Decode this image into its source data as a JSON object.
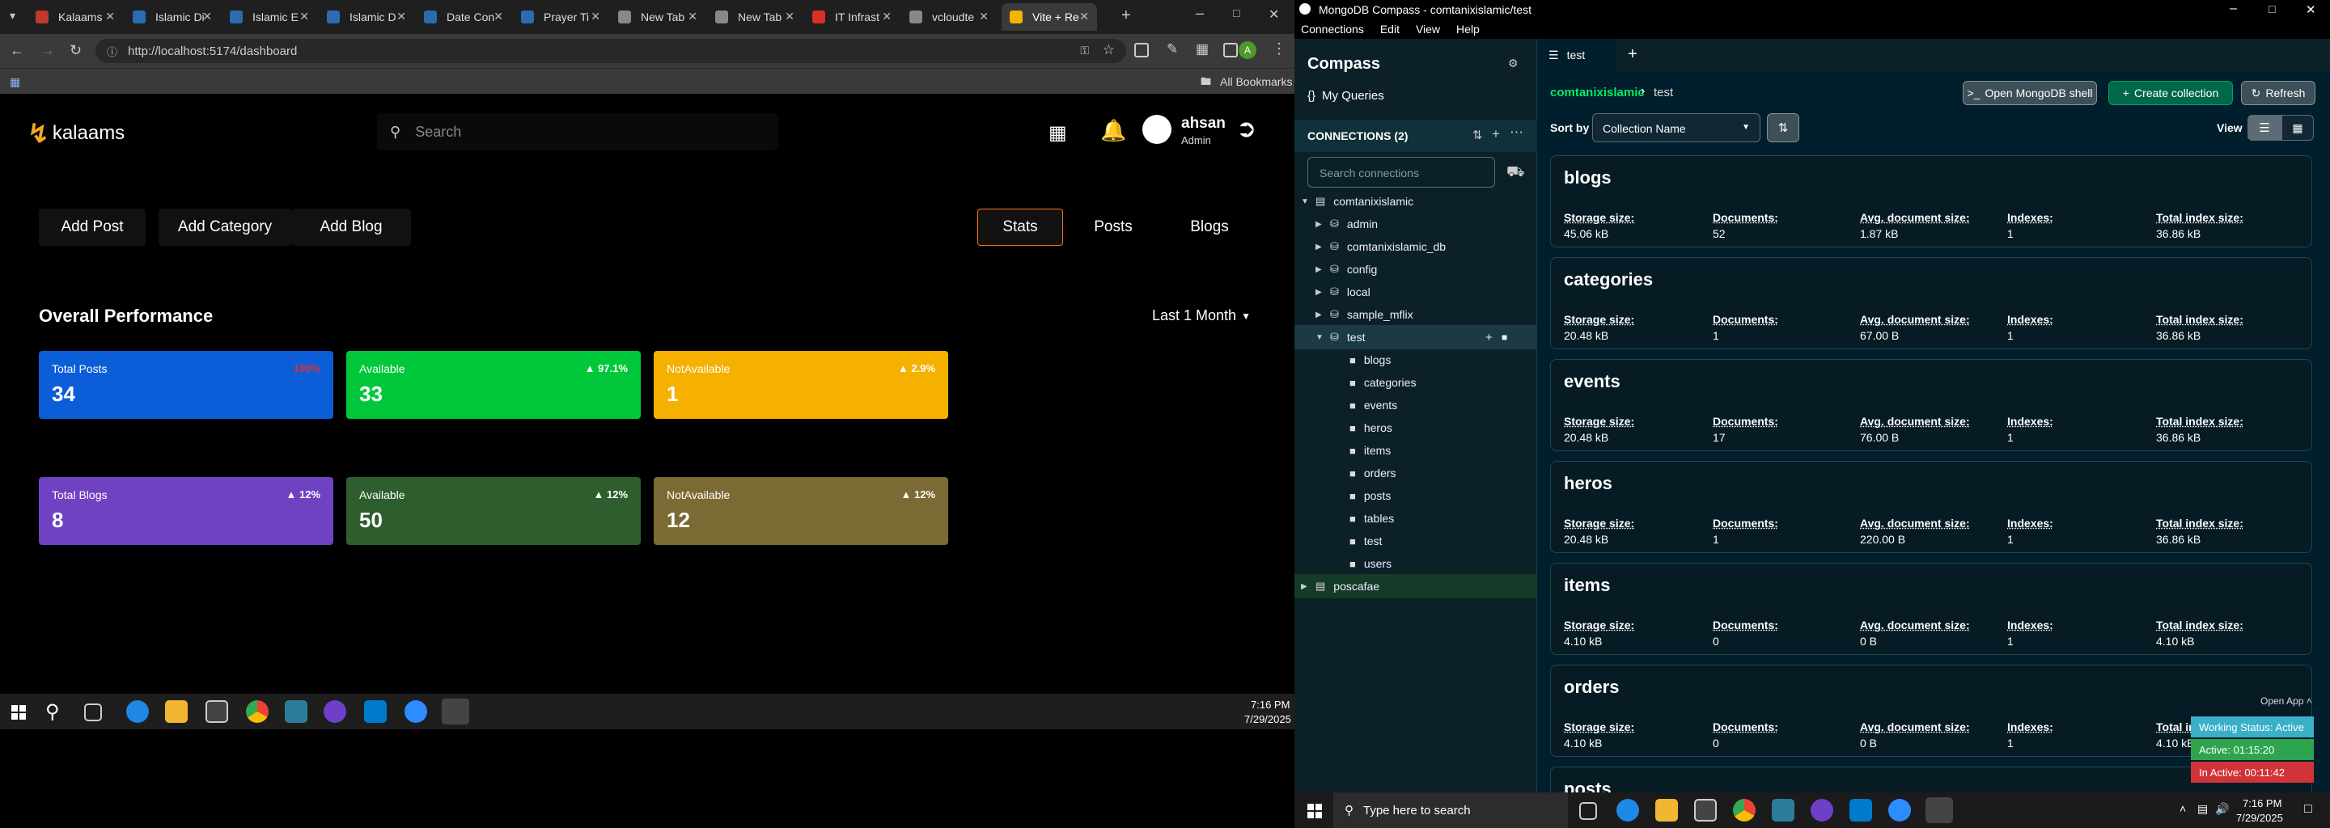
{
  "browser": {
    "tabs": [
      {
        "label": "Kalaams",
        "color": "#c0392b"
      },
      {
        "label": "Islamic Di",
        "color": "#2b6cb0"
      },
      {
        "label": "Islamic E",
        "color": "#2b6cb0"
      },
      {
        "label": "Islamic D",
        "color": "#2b6cb0"
      },
      {
        "label": "Date Con",
        "color": "#2b6cb0"
      },
      {
        "label": "Prayer Ti",
        "color": "#2b6cb0"
      },
      {
        "label": "New Tab",
        "color": "#888888"
      },
      {
        "label": "New Tab",
        "color": "#888888"
      },
      {
        "label": "IT Infrast",
        "color": "#d93025"
      },
      {
        "label": "vcloudte",
        "color": "#888888"
      },
      {
        "label": "Vite + Re",
        "color": "#f5b400"
      }
    ],
    "url": "http://localhost:5174/dashboard",
    "bookmarks_label": "All Bookmarks",
    "profile_initial": "A"
  },
  "app": {
    "logo": "kalaams",
    "search_placeholder": "Search",
    "user_name": "ahsan",
    "user_role": "Admin",
    "left_buttons": [
      "Add Post",
      "Add Category",
      "Add Blog"
    ],
    "right_tabs": [
      "Stats",
      "Posts",
      "Blogs"
    ],
    "section_title": "Overall Performance",
    "period": "Last 1 Month",
    "stats_row1": [
      {
        "label": "Total Posts",
        "value": "34",
        "pct": "100%",
        "color": "#0b5ed7",
        "pct_color": "#e03131"
      },
      {
        "label": "Available",
        "value": "33",
        "pct": "▲ 97.1%",
        "color": "#00c83a",
        "pct_color": "#ffffff"
      },
      {
        "label": "NotAvailable",
        "value": "1",
        "pct": "▲ 2.9%",
        "color": "#f5b000",
        "pct_color": "#ffffff"
      }
    ],
    "stats_row2": [
      {
        "label": "Total Blogs",
        "value": "8",
        "pct": "▲ 12%",
        "color": "#6f42c1",
        "pct_color": "#ffffff"
      },
      {
        "label": "Available",
        "value": "50",
        "pct": "▲ 12%",
        "color": "#2e5d2e",
        "pct_color": "#ffffff"
      },
      {
        "label": "NotAvailable",
        "value": "12",
        "pct": "▲ 12%",
        "color": "#7a6a33",
        "pct_color": "#ffffff"
      }
    ]
  },
  "taskbar1": {
    "time": "7:16 PM",
    "date": "7/29/2025"
  },
  "compass": {
    "title": "MongoDB Compass - comtanixislamic/test",
    "menu": [
      "Connections",
      "Edit",
      "View",
      "Help"
    ],
    "brand": "Compass",
    "my_queries": "My Queries",
    "connections_label": "CONNECTIONS (2)",
    "search_placeholder": "Search connections",
    "tree": [
      {
        "label": "comtanixislamic",
        "level": 0,
        "icon": "server"
      },
      {
        "label": "admin",
        "level": 1,
        "icon": "db"
      },
      {
        "label": "comtanixislamic_db",
        "level": 1,
        "icon": "db"
      },
      {
        "label": "config",
        "level": 1,
        "icon": "db"
      },
      {
        "label": "local",
        "level": 1,
        "icon": "db"
      },
      {
        "label": "sample_mflix",
        "level": 1,
        "icon": "db"
      },
      {
        "label": "test",
        "level": 1,
        "icon": "db"
      },
      {
        "label": "blogs",
        "level": 2,
        "icon": "folder"
      },
      {
        "label": "categories",
        "level": 2,
        "icon": "folder"
      },
      {
        "label": "events",
        "level": 2,
        "icon": "folder"
      },
      {
        "label": "heros",
        "level": 2,
        "icon": "folder"
      },
      {
        "label": "items",
        "level": 2,
        "icon": "folder"
      },
      {
        "label": "orders",
        "level": 2,
        "icon": "folder"
      },
      {
        "label": "posts",
        "level": 2,
        "icon": "folder"
      },
      {
        "label": "tables",
        "level": 2,
        "icon": "folder"
      },
      {
        "label": "test",
        "level": 2,
        "icon": "folder"
      },
      {
        "label": "users",
        "level": 2,
        "icon": "folder"
      },
      {
        "label": "poscafae",
        "level": 0,
        "icon": "server"
      }
    ],
    "tab_label": "test",
    "breadcrumb_db": "comtanixislamic",
    "breadcrumb_coll": "test",
    "open_shell": "Open MongoDB shell",
    "create_collection": "Create collection",
    "refresh": "Refresh",
    "sort_label": "Sort by",
    "sort_value": "Collection Name",
    "view_label": "View",
    "field_labels": [
      "Storage size:",
      "Documents:",
      "Avg. document size:",
      "Indexes:",
      "Total index size:"
    ],
    "collections": [
      {
        "name": "blogs",
        "values": [
          "45.06 kB",
          "52",
          "1.87 kB",
          "1",
          "36.86 kB"
        ]
      },
      {
        "name": "categories",
        "values": [
          "20.48 kB",
          "1",
          "67.00 B",
          "1",
          "36.86 kB"
        ]
      },
      {
        "name": "events",
        "values": [
          "20.48 kB",
          "17",
          "76.00 B",
          "1",
          "36.86 kB"
        ]
      },
      {
        "name": "heros",
        "values": [
          "20.48 kB",
          "1",
          "220.00 B",
          "1",
          "36.86 kB"
        ]
      },
      {
        "name": "items",
        "values": [
          "4.10 kB",
          "0",
          "0 B",
          "1",
          "4.10 kB"
        ]
      },
      {
        "name": "orders",
        "values": [
          "4.10 kB",
          "0",
          "0 B",
          "1",
          "4.10 kB"
        ]
      },
      {
        "name": "posts",
        "values": [
          "",
          "",
          "",
          "",
          ""
        ]
      }
    ],
    "overlay": {
      "open_app": "Open App",
      "working": "Working Status: Active",
      "active": "Active: 01:15:20",
      "inactive": "In Active: 00:11:42"
    }
  },
  "taskbar2": {
    "search_placeholder": "Type here to search",
    "time": "7:16 PM",
    "date": "7/29/2025"
  }
}
